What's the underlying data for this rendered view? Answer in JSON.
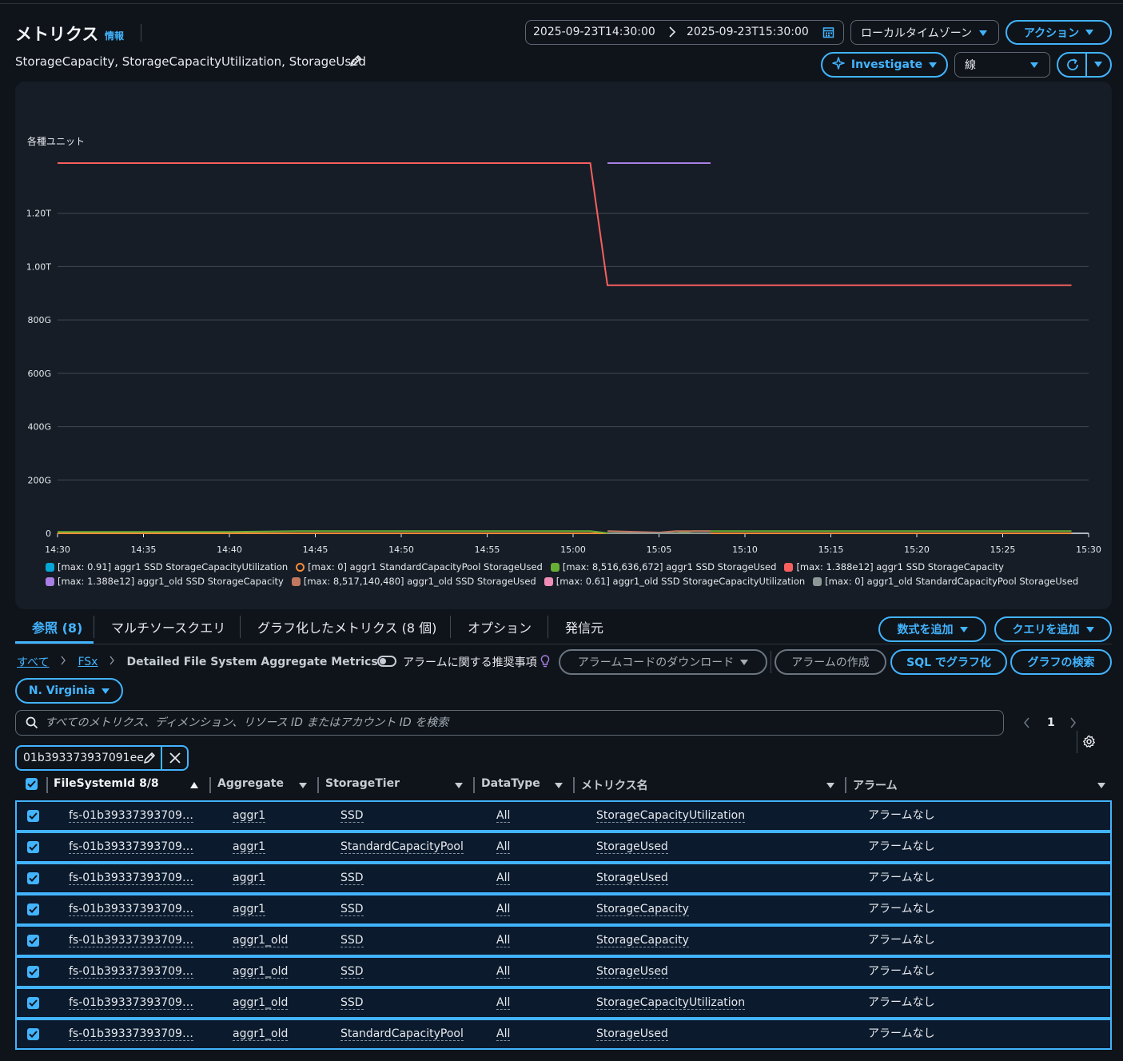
{
  "header": {
    "title": "メトリクス",
    "info_link": "情報",
    "subtitle": "StorageCapacity, StorageCapacityUtilization, StorageUsed",
    "time_start": "2025-09-23T14:30:00",
    "time_end": "2025-09-23T15:30:00",
    "timezone": "ローカルタイムゾーン",
    "actions_label": "アクション",
    "investigate_label": "Investigate",
    "chart_type": "線"
  },
  "chart_data": {
    "type": "line",
    "ylabel": "各種ユニット",
    "x_ticks": [
      "14:30",
      "14:35",
      "14:40",
      "14:45",
      "14:50",
      "14:55",
      "15:00",
      "15:05",
      "15:10",
      "15:15",
      "15:20",
      "15:25",
      "15:30"
    ],
    "y_ticks": [
      "0",
      "200G",
      "400G",
      "600G",
      "800G",
      "1.00T",
      "1.20T"
    ],
    "ylim": [
      0,
      1400000000000
    ],
    "xlim_minutes": [
      0,
      60
    ],
    "grid": true,
    "legend_placement": "bottom",
    "series": [
      {
        "name": "[max: 0.91] aggr1 SSD StorageCapacityUtilization",
        "color": "#08a5d7",
        "points": [
          [
            0,
            0
          ],
          [
            59,
            0
          ]
        ]
      },
      {
        "name": "[max: 0] aggr1 StandardCapacityPool StorageUsed",
        "color": "#fa8b39",
        "points": [
          [
            0,
            0
          ],
          [
            59,
            0
          ]
        ]
      },
      {
        "name": "[max: 8,516,636,672] aggr1 SSD StorageUsed",
        "color": "#69ae34",
        "points": [
          [
            0,
            5000000000
          ],
          [
            10,
            5000000000
          ],
          [
            14,
            8500000000
          ],
          [
            31,
            8500000000
          ],
          [
            32,
            1000000000
          ],
          [
            36,
            1000000000
          ],
          [
            37,
            8500000000
          ],
          [
            59,
            8500000000
          ]
        ]
      },
      {
        "name": "[max: 1.388e12] aggr1 SSD StorageCapacity",
        "color": "#f85f5f",
        "points": [
          [
            0,
            1388000000000
          ],
          [
            31,
            1388000000000
          ],
          [
            32,
            930000000000
          ],
          [
            59,
            930000000000
          ]
        ]
      },
      {
        "name": "[max: 1.388e12] aggr1_old SSD StorageCapacity",
        "color": "#a97fe6",
        "points": [
          [
            32,
            1388000000000
          ],
          [
            38,
            1388000000000
          ]
        ]
      },
      {
        "name": "[max: 8,517,140,480] aggr1_old SSD StorageUsed",
        "color": "#c27760",
        "points": [
          [
            32,
            8500000000
          ],
          [
            35,
            3000000000
          ],
          [
            36,
            8500000000
          ],
          [
            38,
            8500000000
          ]
        ]
      },
      {
        "name": "[max: 0.61] aggr1_old SSD StorageCapacityUtilization",
        "color": "#ee8eb6",
        "points": [
          [
            32,
            0
          ],
          [
            38,
            0
          ]
        ]
      },
      {
        "name": "[max: 0] aggr1_old StandardCapacityPool StorageUsed",
        "color": "#8d9896",
        "points": [
          [
            32,
            0
          ],
          [
            38,
            0
          ]
        ]
      }
    ]
  },
  "tabs": {
    "browse": "参照 (8)",
    "multi_source": "マルチソースクエリ",
    "graphed": "グラフ化したメトリクス (8 個)",
    "options": "オプション",
    "source": "発信元"
  },
  "buttons": {
    "add_math": "数式を追加",
    "add_query": "クエリを追加",
    "alarm_code_download": "アラームコードのダウンロード",
    "create_alarm": "アラームの作成",
    "sql_graph": "SQL でグラフ化",
    "search_graph": "グラフの検索"
  },
  "breadcrumb": {
    "all": "すべて",
    "fsx": "FSx",
    "current": "Detailed File System Aggregate Metrics"
  },
  "alarm_recommend_label": "アラームに関する推奨事項",
  "region": "N. Virginia",
  "search": {
    "placeholder": "すべてのメトリクス、ディメンション、リソース ID またはアカウント ID を検索"
  },
  "pagination": {
    "page": "1"
  },
  "filter_token": "01b393373937091ee",
  "table": {
    "columns": [
      "FileSystemId 8/8",
      "Aggregate",
      "StorageTier",
      "DataType",
      "メトリクス名",
      "アラーム"
    ],
    "rows": [
      {
        "fsid": "fs-01b39337393709…",
        "aggregate": "aggr1",
        "tier": "SSD",
        "datatype": "All",
        "metric": "StorageCapacityUtilization",
        "alarm": "アラームなし"
      },
      {
        "fsid": "fs-01b39337393709…",
        "aggregate": "aggr1",
        "tier": "StandardCapacityPool",
        "datatype": "All",
        "metric": "StorageUsed",
        "alarm": "アラームなし"
      },
      {
        "fsid": "fs-01b39337393709…",
        "aggregate": "aggr1",
        "tier": "SSD",
        "datatype": "All",
        "metric": "StorageUsed",
        "alarm": "アラームなし"
      },
      {
        "fsid": "fs-01b39337393709…",
        "aggregate": "aggr1",
        "tier": "SSD",
        "datatype": "All",
        "metric": "StorageCapacity",
        "alarm": "アラームなし"
      },
      {
        "fsid": "fs-01b39337393709…",
        "aggregate": "aggr1_old",
        "tier": "SSD",
        "datatype": "All",
        "metric": "StorageCapacity",
        "alarm": "アラームなし"
      },
      {
        "fsid": "fs-01b39337393709…",
        "aggregate": "aggr1_old",
        "tier": "SSD",
        "datatype": "All",
        "metric": "StorageUsed",
        "alarm": "アラームなし"
      },
      {
        "fsid": "fs-01b39337393709…",
        "aggregate": "aggr1_old",
        "tier": "SSD",
        "datatype": "All",
        "metric": "StorageCapacityUtilization",
        "alarm": "アラームなし"
      },
      {
        "fsid": "fs-01b39337393709…",
        "aggregate": "aggr1_old",
        "tier": "StandardCapacityPool",
        "datatype": "All",
        "metric": "StorageUsed",
        "alarm": "アラームなし"
      }
    ]
  },
  "colors": {
    "accent": "#42b4ff",
    "background": "#0f141a",
    "panel": "#161d26"
  }
}
